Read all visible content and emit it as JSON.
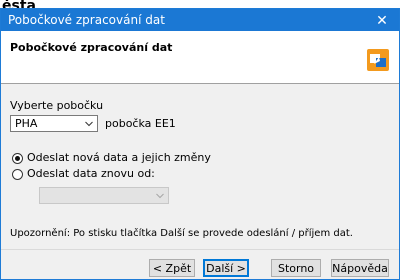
{
  "window": {
    "title": "Pobočkové zpracování dat",
    "close_glyph": "✕"
  },
  "banner": {
    "heading": "Pobočkové zpracování dat",
    "icon": "wizard-icon"
  },
  "branch": {
    "label": "Vyberte pobočku",
    "selected": "PHA",
    "description": "pobočka EE1"
  },
  "options": {
    "send_new": "Odeslat nová data a jejich změny",
    "send_again": "Odeslat data znovu od:",
    "selected": "send_new"
  },
  "notice": "Upozornění: Po stisku tlačítka Další se provede odeslání / příjem dat.",
  "buttons": {
    "back": "< Zpět",
    "next": "Další >",
    "cancel": "Storno",
    "help": "Nápověda"
  },
  "colors": {
    "titlebar": "#1b78d4",
    "dialog_bg": "#f0f0f0",
    "default_button_border": "#0078d7"
  }
}
